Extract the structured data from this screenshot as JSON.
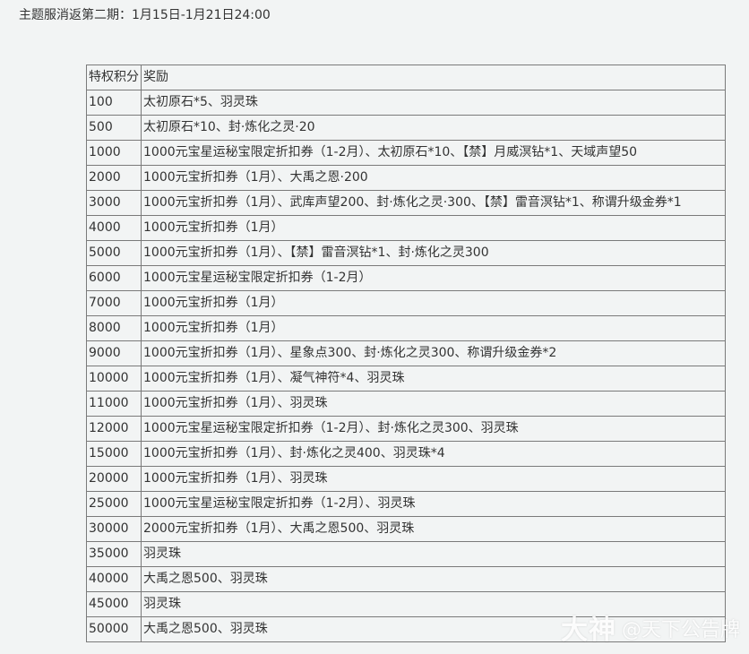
{
  "header": {
    "text": "主题服消返第二期：1月15日-1月21日24:00"
  },
  "table": {
    "headers": [
      "特权积分",
      "奖励"
    ],
    "rows": [
      {
        "points": "100",
        "reward": "太初原石*5、羽灵珠"
      },
      {
        "points": "500",
        "reward": "太初原石*10、封·炼化之灵·20"
      },
      {
        "points": "1000",
        "reward": "1000元宝星运秘宝限定折扣券（1-2月）、太初原石*10、【禁】月威溟钻*1、天域声望50"
      },
      {
        "points": "2000",
        "reward": "1000元宝折扣券（1月）、大禹之恩·200"
      },
      {
        "points": "3000",
        "reward": "1000元宝折扣券（1月）、武库声望200、封·炼化之灵·300、【禁】雷音溟钻*1、称谓升级金券*1"
      },
      {
        "points": "4000",
        "reward": "1000元宝折扣券（1月）"
      },
      {
        "points": "5000",
        "reward": "1000元宝折扣券（1月）、【禁】雷音溟钻*1、封·炼化之灵300"
      },
      {
        "points": "6000",
        "reward": "1000元宝星运秘宝限定折扣券（1-2月）"
      },
      {
        "points": "7000",
        "reward": "1000元宝折扣券（1月）"
      },
      {
        "points": "8000",
        "reward": "1000元宝折扣券（1月）"
      },
      {
        "points": "9000",
        "reward": "1000元宝折扣券（1月）、星象点300、封·炼化之灵300、称谓升级金券*2"
      },
      {
        "points": "10000",
        "reward": "1000元宝折扣券（1月）、凝气神符*4、羽灵珠"
      },
      {
        "points": "11000",
        "reward": "1000元宝折扣券（1月）、羽灵珠"
      },
      {
        "points": "12000",
        "reward": "1000元宝星运秘宝限定折扣券（1-2月）、封·炼化之灵300、羽灵珠"
      },
      {
        "points": "15000",
        "reward": "1000元宝折扣券（1月）、封·炼化之灵400、羽灵珠*4"
      },
      {
        "points": "20000",
        "reward": "1000元宝折扣券（1月）、羽灵珠"
      },
      {
        "points": "25000",
        "reward": "1000元宝星运秘宝限定折扣券（1-2月）、羽灵珠"
      },
      {
        "points": "30000",
        "reward": "2000元宝折扣券（1月）、大禹之恩500、羽灵珠"
      },
      {
        "points": "35000",
        "reward": "羽灵珠"
      },
      {
        "points": "40000",
        "reward": "大禹之恩500、羽灵珠"
      },
      {
        "points": "45000",
        "reward": "羽灵珠"
      },
      {
        "points": "50000",
        "reward": "大禹之恩500、羽灵珠"
      }
    ]
  },
  "watermark": {
    "logo": "大神",
    "text": "@天下公告牌"
  }
}
